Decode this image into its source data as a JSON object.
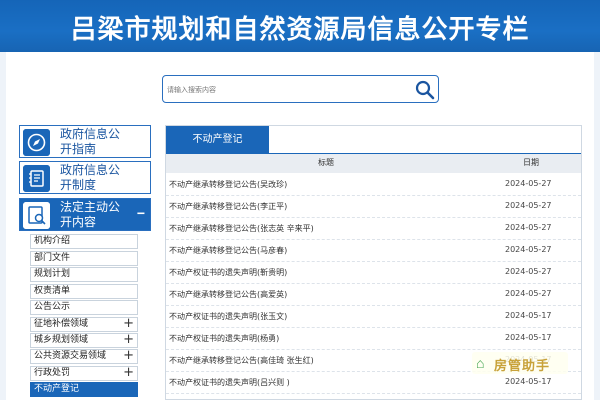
{
  "header": {
    "title": "吕梁市规划和自然资源局信息公开专栏"
  },
  "search": {
    "placeholder": "请输入搜索内容"
  },
  "sidebar": {
    "sections": [
      {
        "label": "政府信息公开指南",
        "icon": "compass-icon",
        "active": false
      },
      {
        "label": "政府信息公开制度",
        "icon": "notebook-icon",
        "active": false
      },
      {
        "label": "法定主动公开内容",
        "icon": "search-document-icon",
        "active": true,
        "toggle": "−"
      }
    ],
    "items": [
      {
        "label": "机构介绍",
        "expandable": false
      },
      {
        "label": "部门文件",
        "expandable": false
      },
      {
        "label": "规划计划",
        "expandable": false
      },
      {
        "label": "权责清单",
        "expandable": false
      },
      {
        "label": "公告公示",
        "expandable": false
      },
      {
        "label": "征地补偿领域",
        "expandable": true
      },
      {
        "label": "城乡规划领域",
        "expandable": true
      },
      {
        "label": "公共资源交易领域",
        "expandable": true
      },
      {
        "label": "行政处罚",
        "expandable": true
      },
      {
        "label": "不动产登记",
        "expandable": false,
        "active": true
      }
    ],
    "expand_symbol": "+"
  },
  "main": {
    "tab": "不动产登记",
    "columns": {
      "title": "标题",
      "date": "日期"
    },
    "rows": [
      {
        "title": "不动产继承转移登记公告(吴改珍)",
        "date": "2024-05-27"
      },
      {
        "title": "不动产继承转移登记公告(李正平)",
        "date": "2024-05-27"
      },
      {
        "title": "不动产继承转移登记公告(张志英 辛来平)",
        "date": "2024-05-27"
      },
      {
        "title": "不动产继承转移登记公告(马彦春)",
        "date": "2024-05-27"
      },
      {
        "title": "不动产权证书的遗失声明(靳贵明)",
        "date": "2024-05-27"
      },
      {
        "title": "不动产继承转移登记公告(高爱英)",
        "date": "2024-05-27"
      },
      {
        "title": "不动产权证书的遗失声明(张玉文)",
        "date": "2024-05-17"
      },
      {
        "title": "不动产权证书的遗失声明(杨勇)",
        "date": "2024-05-17"
      },
      {
        "title": "不动产继承转移登记公告(高佳琦 张生红)",
        "date": "2024-05-17"
      },
      {
        "title": "不动产权证书的遗失声明(吕兴则 )",
        "date": "2024-05-17"
      }
    ]
  },
  "watermark": {
    "text": "房管助手",
    "icon": "app-logo-icon"
  },
  "colors": {
    "primary": "#1a66b8",
    "header_bg": "#eef3f9"
  }
}
